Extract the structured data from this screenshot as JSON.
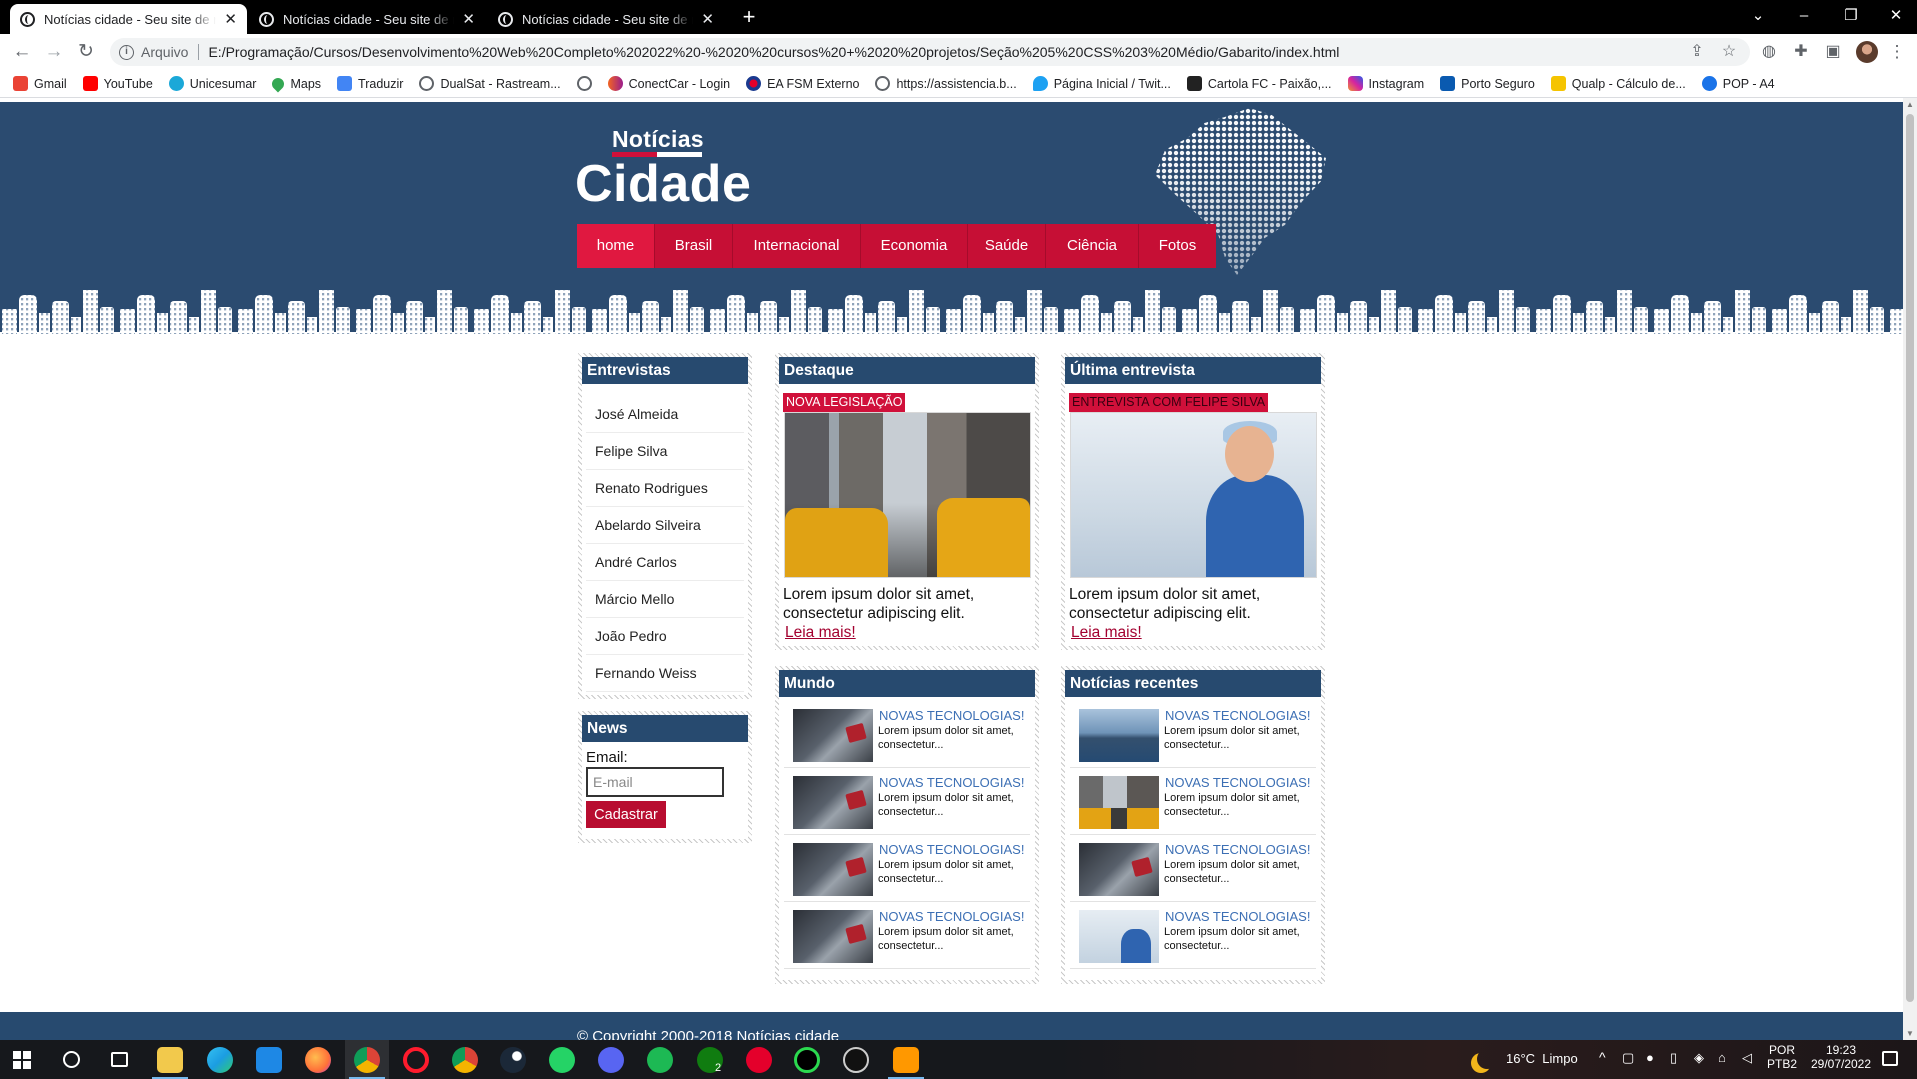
{
  "browser": {
    "tabs": [
      {
        "title": "Notícias cidade - Seu site de not"
      },
      {
        "title": "Notícias cidade - Seu site de not"
      },
      {
        "title": "Notícias cidade - Seu site de not"
      }
    ],
    "new_tab_label": "+",
    "omnibox": {
      "scheme_label": "Arquivo",
      "url": "E:/Programação/Cursos/Desenvolvimento%20Web%20Completo%202022%20-%2020%20cursos%20+%2020%20projetos/Seção%205%20CSS%203%20Médio/Gabarito/index.html"
    },
    "bookmarks": [
      {
        "label": "Gmail",
        "icon": "gmail-icon",
        "color": "#ea4335"
      },
      {
        "label": "YouTube",
        "icon": "youtube-icon",
        "color": "#ff0000"
      },
      {
        "label": "Unicesumar",
        "icon": "unicesumar-icon",
        "color": "#1ba8d8"
      },
      {
        "label": "Maps",
        "icon": "maps-icon",
        "color": "#34a853"
      },
      {
        "label": "Traduzir",
        "icon": "translate-icon",
        "color": "#4285f4"
      },
      {
        "label": "DualSat - Rastream...",
        "icon": "globe-icon",
        "color": "#5f6368"
      },
      {
        "label": "",
        "icon": "globe-icon",
        "color": "#5f6368"
      },
      {
        "label": "ConectCar - Login",
        "icon": "conectcar-icon",
        "color": "#f26522"
      },
      {
        "label": "EA FSM Externo",
        "icon": "ea-icon",
        "color": "#1a3a8f"
      },
      {
        "label": "https://assistencia.b...",
        "icon": "globe-icon",
        "color": "#5f6368"
      },
      {
        "label": "Página Inicial / Twit...",
        "icon": "twitter-icon",
        "color": "#1da1f2"
      },
      {
        "label": "Cartola FC - Paixão,...",
        "icon": "cartola-icon",
        "color": "#222222"
      },
      {
        "label": "Instagram",
        "icon": "instagram-icon",
        "color": "#d6249f"
      },
      {
        "label": "Porto Seguro",
        "icon": "porto-seguro-icon",
        "color": "#0a5ab0"
      },
      {
        "label": "Qualp - Cálculo de...",
        "icon": "qualp-icon",
        "color": "#f5c400"
      },
      {
        "label": "POP - A4",
        "icon": "pop-icon",
        "color": "#1a73e8"
      }
    ]
  },
  "site": {
    "logo": {
      "small": "Notícias",
      "big": "Cidade"
    },
    "nav": [
      "home",
      "Brasil",
      "Internacional",
      "Economia",
      "Saúde",
      "Ciência",
      "Fotos"
    ],
    "interviews": {
      "title": "Entrevistas",
      "items": [
        "José Almeida",
        "Felipe Silva",
        "Renato Rodrigues",
        "Abelardo Silveira",
        "André Carlos",
        "Márcio Mello",
        "João Pedro",
        "Fernando Weiss"
      ]
    },
    "newsletter": {
      "title": "News",
      "email_label": "Email:",
      "email_placeholder": "E-mail",
      "submit_label": "Cadastrar"
    },
    "featured": {
      "title": "Destaque",
      "tag": "NOVA LEGISLAÇÃO",
      "text": "Lorem ipsum dolor sit amet, consectetur adipiscing elit.",
      "link": "Leia mais!"
    },
    "latest_interview": {
      "title": "Última entrevista",
      "tag": "ENTREVISTA COM FELIPE SILVA",
      "text": "Lorem ipsum dolor sit amet, consectetur adipiscing elit.",
      "link": "Leia mais!"
    },
    "world": {
      "title": "Mundo",
      "items": [
        {
          "title": "NOVAS TECNOLOGIAS!",
          "text": "Lorem ipsum dolor sit amet, consectetur..."
        },
        {
          "title": "NOVAS TECNOLOGIAS!",
          "text": "Lorem ipsum dolor sit amet, consectetur..."
        },
        {
          "title": "NOVAS TECNOLOGIAS!",
          "text": "Lorem ipsum dolor sit amet, consectetur..."
        },
        {
          "title": "NOVAS TECNOLOGIAS!",
          "text": "Lorem ipsum dolor sit amet, consectetur..."
        }
      ]
    },
    "recent": {
      "title": "Notícias recentes",
      "items": [
        {
          "title": "NOVAS TECNOLOGIAS!",
          "text": "Lorem ipsum dolor sit amet, consectetur..."
        },
        {
          "title": "NOVAS TECNOLOGIAS!",
          "text": "Lorem ipsum dolor sit amet, consectetur..."
        },
        {
          "title": "NOVAS TECNOLOGIAS!",
          "text": "Lorem ipsum dolor sit amet, consectetur..."
        },
        {
          "title": "NOVAS TECNOLOGIAS!",
          "text": "Lorem ipsum dolor sit amet, consectetur..."
        }
      ]
    },
    "footer": "© Copyright 2000-2018 Notícias cidade",
    "colors": {
      "header": "#2b4b70",
      "accent": "#c60f35",
      "panel_header": "#274a6f",
      "link": "#a3002f"
    }
  },
  "taskbar": {
    "weather": "16°C  Limpo",
    "lang": "POR",
    "layout": "PTB2",
    "time": "19:23",
    "date": "29/07/2022",
    "xbox_badge": "2"
  }
}
